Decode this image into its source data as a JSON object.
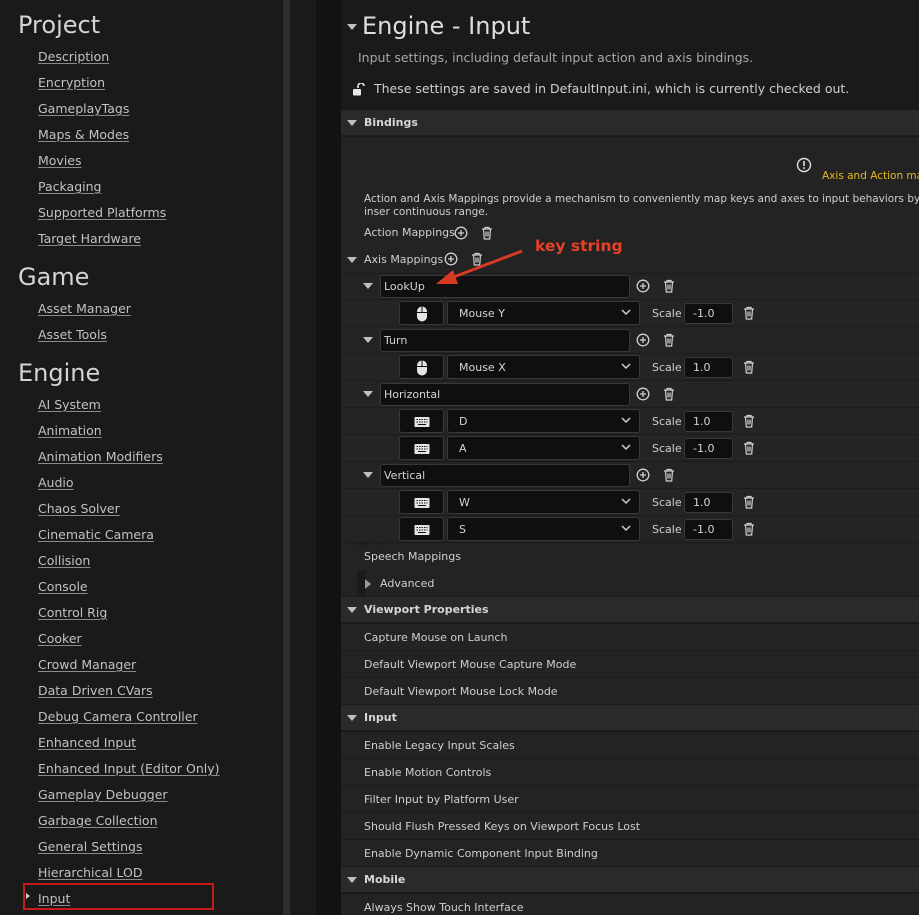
{
  "sidebar": {
    "categories": {
      "project": "Project",
      "game": "Game",
      "engine": "Engine"
    },
    "project_items": [
      "Description",
      "Encryption",
      "GameplayTags",
      "Maps & Modes",
      "Movies",
      "Packaging",
      "Supported Platforms",
      "Target Hardware"
    ],
    "game_items": [
      "Asset Manager",
      "Asset Tools"
    ],
    "engine_items": [
      "AI System",
      "Animation",
      "Animation Modifiers",
      "Audio",
      "Chaos Solver",
      "Cinematic Camera",
      "Collision",
      "Console",
      "Control Rig",
      "Cooker",
      "Crowd Manager",
      "Data Driven CVars",
      "Debug Camera Controller",
      "Enhanced Input",
      "Enhanced Input (Editor Only)",
      "Gameplay Debugger",
      "Garbage Collection",
      "General Settings",
      "Hierarchical LOD",
      "Input"
    ],
    "selected": "Input",
    "highlight_color": "#c41b1b"
  },
  "header": {
    "title": "Engine - Input",
    "description": "Input settings, including default input action and axis bindings.",
    "saved_note": "These settings are saved in DefaultInput.ini, which is currently checked out."
  },
  "bindings": {
    "section_label": "Bindings",
    "warning_text": "Axis and Action ma",
    "warning_color": "#e5b820",
    "description": "Action and Axis Mappings provide a mechanism to conveniently map keys and axes to input behaviors by inser continuous range.",
    "action_mappings_label": "Action Mappings",
    "axis_mappings_label": "Axis Mappings",
    "scale_label": "Scale",
    "axes": [
      {
        "name": "LookUp",
        "keys": [
          {
            "device": "mouse-icon",
            "key": "Mouse Y",
            "scale": "-1.0"
          }
        ]
      },
      {
        "name": "Turn",
        "keys": [
          {
            "device": "mouse-icon",
            "key": "Mouse X",
            "scale": "1.0"
          }
        ]
      },
      {
        "name": "Horizontal",
        "keys": [
          {
            "device": "keyboard-icon",
            "key": "D",
            "scale": "1.0"
          },
          {
            "device": "keyboard-icon",
            "key": "A",
            "scale": "-1.0"
          }
        ]
      },
      {
        "name": "Vertical",
        "keys": [
          {
            "device": "keyboard-icon",
            "key": "W",
            "scale": "1.0"
          },
          {
            "device": "keyboard-icon",
            "key": "S",
            "scale": "-1.0"
          }
        ]
      }
    ],
    "speech_mappings_label": "Speech Mappings",
    "advanced_label": "Advanced"
  },
  "viewport": {
    "section_label": "Viewport Properties",
    "rows": [
      "Capture Mouse on Launch",
      "Default Viewport Mouse Capture Mode",
      "Default Viewport Mouse Lock Mode"
    ]
  },
  "input": {
    "section_label": "Input",
    "rows": [
      "Enable Legacy Input Scales",
      "Enable Motion Controls",
      "Filter Input by Platform User",
      "Should Flush Pressed Keys on Viewport Focus Lost",
      "Enable Dynamic Component Input Binding"
    ]
  },
  "mobile": {
    "section_label": "Mobile",
    "rows": [
      "Always Show Touch Interface"
    ]
  },
  "annotation": {
    "text": "key string",
    "color": "#e8412a"
  }
}
